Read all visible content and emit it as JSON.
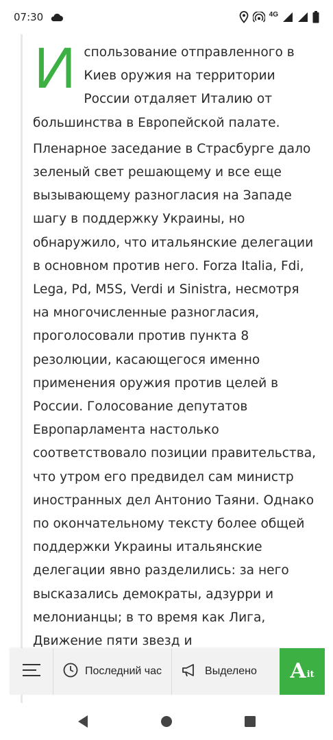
{
  "status_bar": {
    "time": "07:30",
    "network_label": "4G",
    "icons": [
      "cloud-icon",
      "location-icon",
      "hotspot-icon",
      "signal-icon",
      "signal-icon",
      "battery-icon"
    ]
  },
  "article": {
    "drop_cap": "И",
    "lead_rest": "спользование отправленного в Киев оружия на территории России отдаляет Италию от большинства в Европейской палате.",
    "body": "Пленарное заседание в Страсбурге дало зеленый свет решающему и все еще вызывающему разногласия на Западе шагу в поддержку Украины, но обнаружило, что итальянские делегации в основном против него. Forza Italia, Fdi, Lega, Pd, M5S, Verdi и Sinistra, несмотря на многочисленные разногласия, проголосовали против пункта 8 резолюции, касающегося именно применения оружия против целей в России. Голосование депутатов Европарламента настолько соответствовало позиции правительства, что утром его предвидел сам министр иностранных дел Антонио Таяни. Однако по окончательному тексту более общей поддержки Украины итальянские делегации явно разделились: за него высказались демократы, адзурри и мелонианцы; в то время как Лига, Движение пяти звезд и"
  },
  "bottom_bar": {
    "last_hour_label": "Последний час",
    "highlighted_label": "Выделено",
    "logo_text": "A",
    "logo_suffix": "it",
    "accent_color": "#3cb043"
  },
  "nav": {
    "buttons": [
      "back",
      "home",
      "recents"
    ]
  }
}
